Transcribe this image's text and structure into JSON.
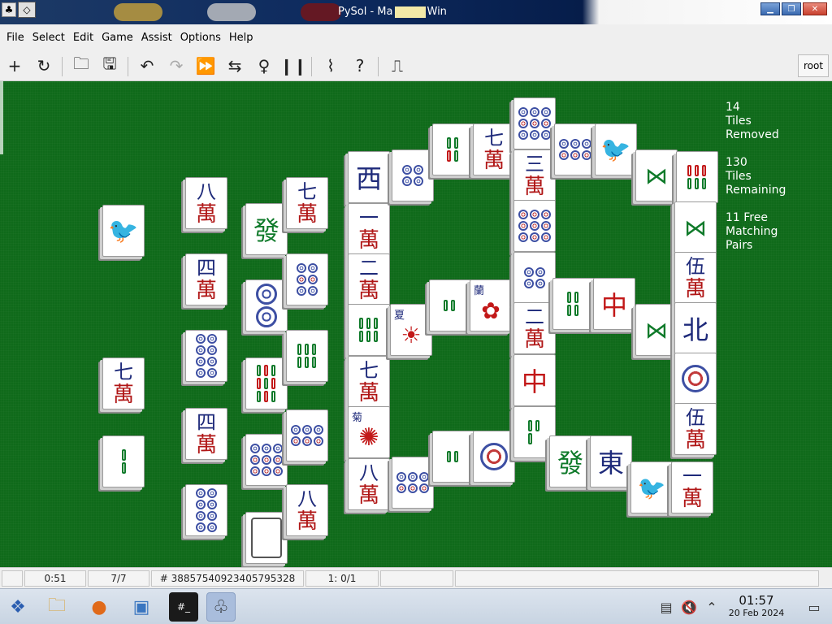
{
  "window": {
    "title": "PySol - Mahjongg Win",
    "title_visible": "PySol - Ma",
    "title_tail": "Win"
  },
  "menu": {
    "items": [
      "File",
      "Select",
      "Edit",
      "Game",
      "Assist",
      "Options",
      "Help"
    ]
  },
  "toolbar": {
    "user": "root",
    "icons": [
      "new-game-icon",
      "restart-icon",
      "open-icon",
      "save-icon",
      "undo-icon",
      "redo-icon",
      "autodrop-icon",
      "shuffle-icon",
      "hint-icon",
      "pause-icon",
      "statistics-icon",
      "help-icon",
      "quit-icon"
    ]
  },
  "stats": {
    "removed": "14\nTiles\nRemoved",
    "remaining": "130\nTiles\nRemaining",
    "pairs": "11 Free\nMatching\nPairs"
  },
  "statusbar": {
    "time": "0:51",
    "moves": "7/7",
    "game_number": "# 38857540923405795328",
    "score": "1: 0/1"
  },
  "taskbar": {
    "time": "01:57",
    "date": "20 Feb 2024"
  },
  "tiles": {
    "ba": "八",
    "qi": "七",
    "si": "四",
    "yi": "一",
    "er": "二",
    "san": "三",
    "wu": "伍",
    "wan": "萬",
    "fa": "發",
    "zhong": "中",
    "xi": "西",
    "bei": "北",
    "dong": "東",
    "lan": "蘭",
    "ju": "菊",
    "xia": "夏"
  }
}
